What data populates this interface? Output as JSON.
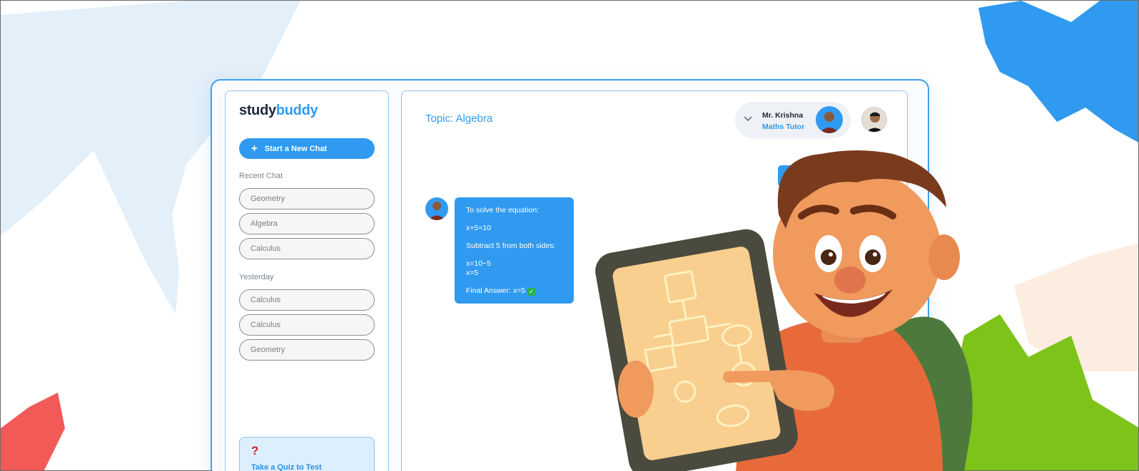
{
  "brand": {
    "part1": "study",
    "part2": "buddy"
  },
  "sidebar": {
    "new_chat_label": "Start a New Chat",
    "groups": [
      {
        "label": "Recent Chat",
        "items": [
          "Geometry",
          "Algebra",
          "Calculus"
        ]
      },
      {
        "label": "Yesterday",
        "items": [
          "Calculus",
          "Calculus",
          "Geometry"
        ]
      }
    ],
    "quiz": {
      "icon": "?",
      "text": "Take a Quiz to Test"
    }
  },
  "main": {
    "topic": "Topic: Algebra",
    "tutor": {
      "name": "Mr. Krishna",
      "role": "Maths Tutor"
    },
    "message": {
      "lines": [
        "To solve the equation:",
        "x+5=10",
        "Subtract 5 from both sides:",
        "x=10−5",
        "x=5",
        "Final Answer: x=5"
      ],
      "check_icon": "check-box-emoji"
    }
  },
  "colors": {
    "accent": "#2f9af0",
    "text_dark": "#1d2738",
    "quiz_bg": "#ddeefc",
    "quiz_icon": "#d4202a"
  }
}
